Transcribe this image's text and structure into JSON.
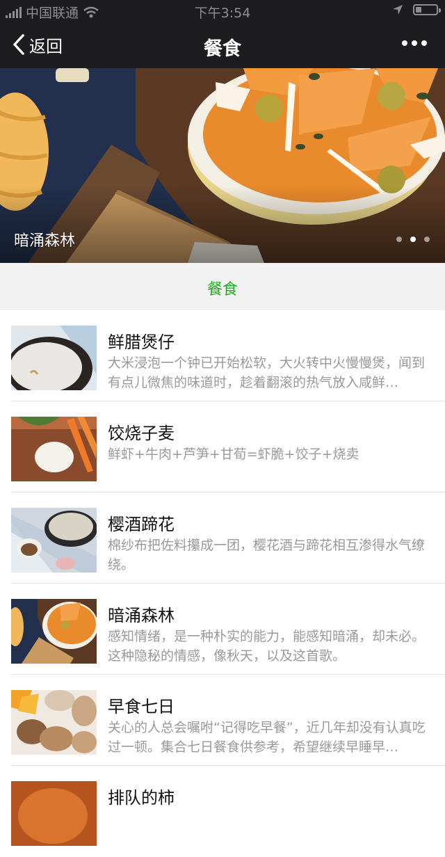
{
  "status_bar": {
    "carrier": "中国联通",
    "time": "下午3:54",
    "signal_icon": "signal-bars-icon",
    "wifi_icon": "wifi-icon",
    "location_icon": "location-arrow-icon",
    "battery_level": 0.3
  },
  "nav": {
    "back_label": "返回",
    "title": "餐食",
    "back_icon": "chevron-left-icon",
    "more_icon": "more-dots-icon"
  },
  "banner": {
    "caption": "暗涌森林",
    "slide_count": 3,
    "active_slide": 1
  },
  "category": {
    "label": "餐食",
    "color": "#1aad19"
  },
  "articles": [
    {
      "title": "鲜腊煲仔",
      "desc": "大米浸泡一个钟已开始松软，大火转中火慢慢煲，闻到有点儿微焦的味道时，趁着翻滚的热气放入咸鲜…"
    },
    {
      "title": "饺烧子麦",
      "desc": "鲜虾+牛肉+芦笋+甘荀=虾脆+饺子+烧卖"
    },
    {
      "title": "樱酒蹄花",
      "desc": "棉纱布把佐料攥成一团，樱花酒与蹄花相互渗得水气缭绕。"
    },
    {
      "title": "暗涌森林",
      "desc": "感知情绪，是一种朴实的能力，能感知暗涌，却未必。这种隐秘的情感，像秋天，以及这首歌。"
    },
    {
      "title": "早食七日",
      "desc": "关心的人总会嘱咐“记得吃早餐”，近几年却没有认真吃过一顿。集合七日餐食供参考，希望继续早睡早…"
    },
    {
      "title": "排队的柿",
      "desc": ""
    }
  ]
}
